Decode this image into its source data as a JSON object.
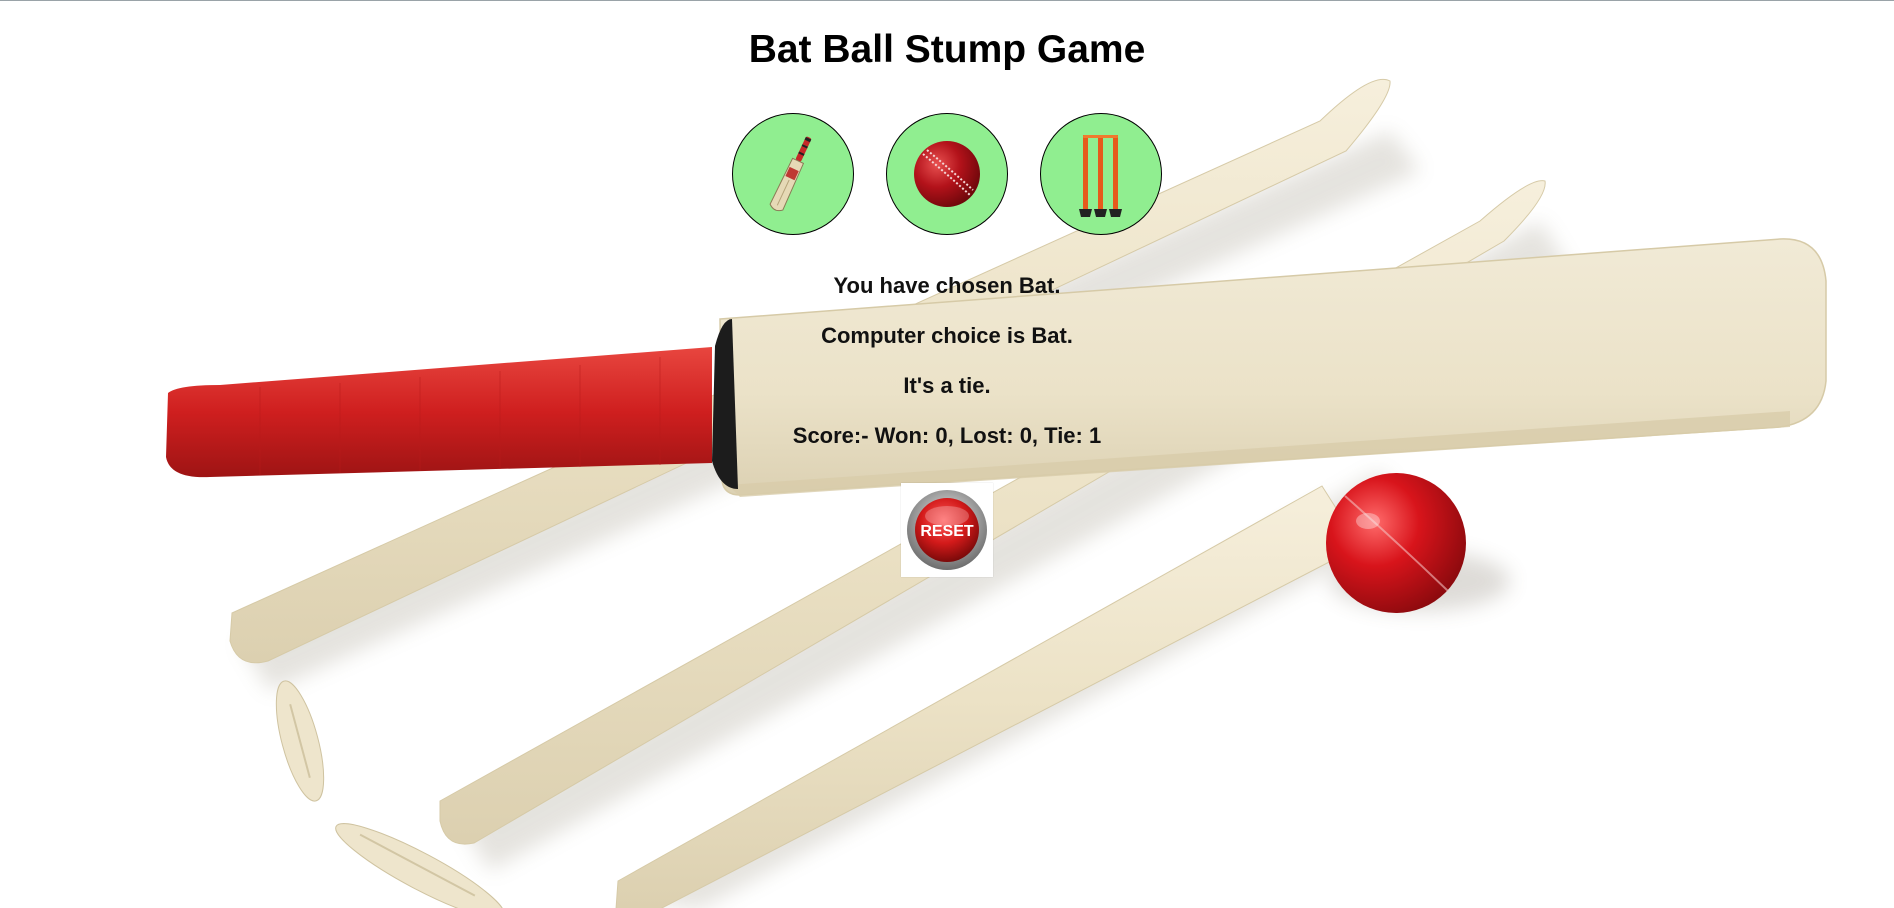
{
  "game": {
    "title": "Bat Ball Stump Game"
  },
  "choices": [
    {
      "name": "Bat",
      "icon": "cricket-bat-icon"
    },
    {
      "name": "Ball",
      "icon": "cricket-ball-icon"
    },
    {
      "name": "Stump",
      "icon": "stumps-icon"
    }
  ],
  "results": {
    "user_choice": "You have chosen Bat.",
    "computer_choice": "Computer choice is Bat.",
    "outcome": "It's a tie.",
    "score": "Score:- Won: 0, Lost: 0, Tie: 1"
  },
  "reset_button": {
    "label": "RESET"
  },
  "colors": {
    "choice_bg": "#90ee90",
    "reset_red": "#d31a1a",
    "grip_red": "#d42a2a",
    "wood": "#efe6cf"
  }
}
